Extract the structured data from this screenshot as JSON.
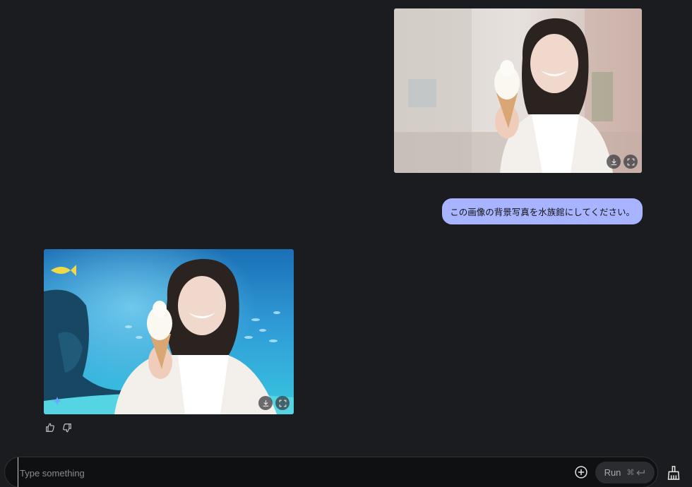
{
  "user_image": {
    "alt": "Smiling girl holding a soft-serve ice cream cone outdoors"
  },
  "user_message": {
    "text": "この画像の背景写真を水族館にしてください。"
  },
  "model_image": {
    "alt": "Same girl with ice cream in front of an aquarium background"
  },
  "image_actions": {
    "download_icon": "download-icon",
    "fullscreen_icon": "fullscreen-icon"
  },
  "feedback": {
    "thumbs_up_icon": "thumbs-up-icon",
    "thumbs_down_icon": "thumbs-down-icon"
  },
  "input": {
    "placeholder": "Type something",
    "value": ""
  },
  "run_button": {
    "label": "Run",
    "shortcut": "⌘"
  },
  "colors": {
    "background": "#1b1c1f",
    "bubble": "#a8b4ff",
    "input_bg": "#0f1012"
  }
}
